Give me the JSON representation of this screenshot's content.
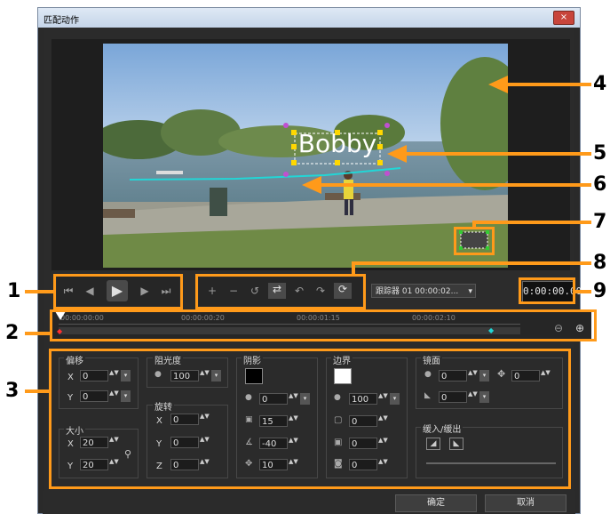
{
  "window": {
    "title": "匹配动作",
    "close_label": "×"
  },
  "video": {
    "tracked_text": "Bobby"
  },
  "playback": {
    "buttons": [
      "home-icon",
      "prev-frame-icon",
      "play-icon",
      "next-frame-icon",
      "end-icon"
    ]
  },
  "tracker": {
    "selector_label": "跟踪器 01   00:00:02...",
    "timecode": "0:00:00.00"
  },
  "timeline": {
    "ticks": [
      "00:00:00:00",
      "00:00:00:20",
      "00:00:01:15",
      "00:00:02:10"
    ]
  },
  "offset": {
    "title": "偏移",
    "x_label": "X",
    "x_value": "0",
    "y_label": "Y",
    "y_value": "0"
  },
  "opacity": {
    "title": "阻光度",
    "value": "100"
  },
  "size": {
    "title": "大小",
    "x_label": "X",
    "x_value": "20",
    "y_label": "Y",
    "y_value": "20"
  },
  "rotation": {
    "title": "旋转",
    "x_label": "X",
    "x_value": "0",
    "y_label": "Y",
    "y_value": "0",
    "z_label": "Z",
    "z_value": "0"
  },
  "shadow": {
    "title": "阴影",
    "color": "#000000",
    "v1": "0",
    "v2": "15",
    "v3": "-40",
    "v4": "10"
  },
  "border": {
    "title": "边界",
    "color": "#ffffff",
    "v1": "100",
    "v2": "0",
    "v3": "0",
    "v4": "0"
  },
  "mirror": {
    "title": "镜面",
    "v1": "0",
    "v2": "0",
    "v3": "0"
  },
  "fade": {
    "title": "缓入/缓出"
  },
  "footer": {
    "ok_label": "确定",
    "cancel_label": "取消"
  },
  "callouts": {
    "c1": "1",
    "c2": "2",
    "c3": "3",
    "c4": "4",
    "c5": "5",
    "c6": "6",
    "c7": "7",
    "c8": "8",
    "c9": "9"
  },
  "colors": {
    "callout": "#ff9a1a",
    "dialog_bg": "#2b2b2b"
  }
}
